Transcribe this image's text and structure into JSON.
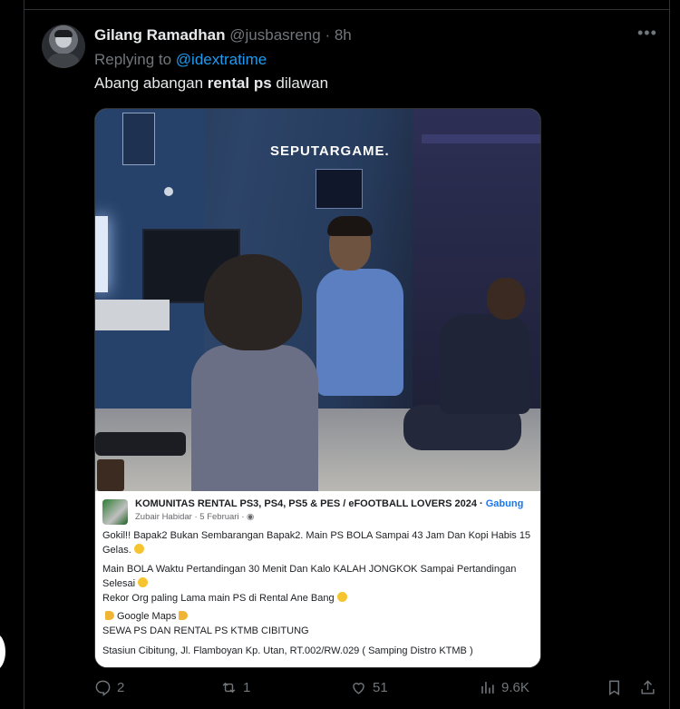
{
  "tweet": {
    "display_name": "Gilang Ramadhan",
    "handle": "@jusbasreng",
    "separator": "·",
    "time": "8h",
    "reply_prefix": "Replying to",
    "reply_to": "@idextratime",
    "text_part1": "Abang abangan ",
    "text_bold": "rental ps",
    "text_part2": " dilawan"
  },
  "media": {
    "photo_watermark": "SEPUTARGAME.",
    "fb_post": {
      "group": "KOMUNITAS RENTAL PS3, PS4, PS5 & PES / eFOOTBALL LOVERS 2024",
      "join_separator": " · ",
      "join_label": "Gabung",
      "author": "Zubair Habidar",
      "date": "· 5 Februari ·",
      "line1": "Gokil!! Bapak2 Bukan Sembarangan Bapak2. Main PS BOLA Sampai 43 Jam Dan Kopi Habis 15",
      "line2": "Gelas.",
      "line3": "Main BOLA Waktu Pertandingan 30 Menit Dan Kalo KALAH JONGKOK Sampai Pertandingan",
      "line4": "Selesai",
      "line5": "Rekor Org paling Lama main PS di Rental Ane Bang",
      "line6": "Google Maps",
      "line7": "SEWA PS DAN RENTAL PS KTMB CIBITUNG",
      "line8": "Stasiun Cibitung, Jl. Flamboyan Kp. Utan, RT.002/RW.029 ( Samping Distro KTMB )"
    }
  },
  "actions": {
    "replies": "2",
    "reposts": "1",
    "likes": "51",
    "views": "9.6K"
  },
  "colors": {
    "background": "#000000",
    "text": "#e7e9ea",
    "muted": "#71767b",
    "link": "#1d9bf0",
    "border": "#2f3336"
  },
  "icons": [
    "more-icon",
    "reply-icon",
    "repost-icon",
    "like-icon",
    "views-icon",
    "bookmark-icon",
    "share-icon"
  ]
}
